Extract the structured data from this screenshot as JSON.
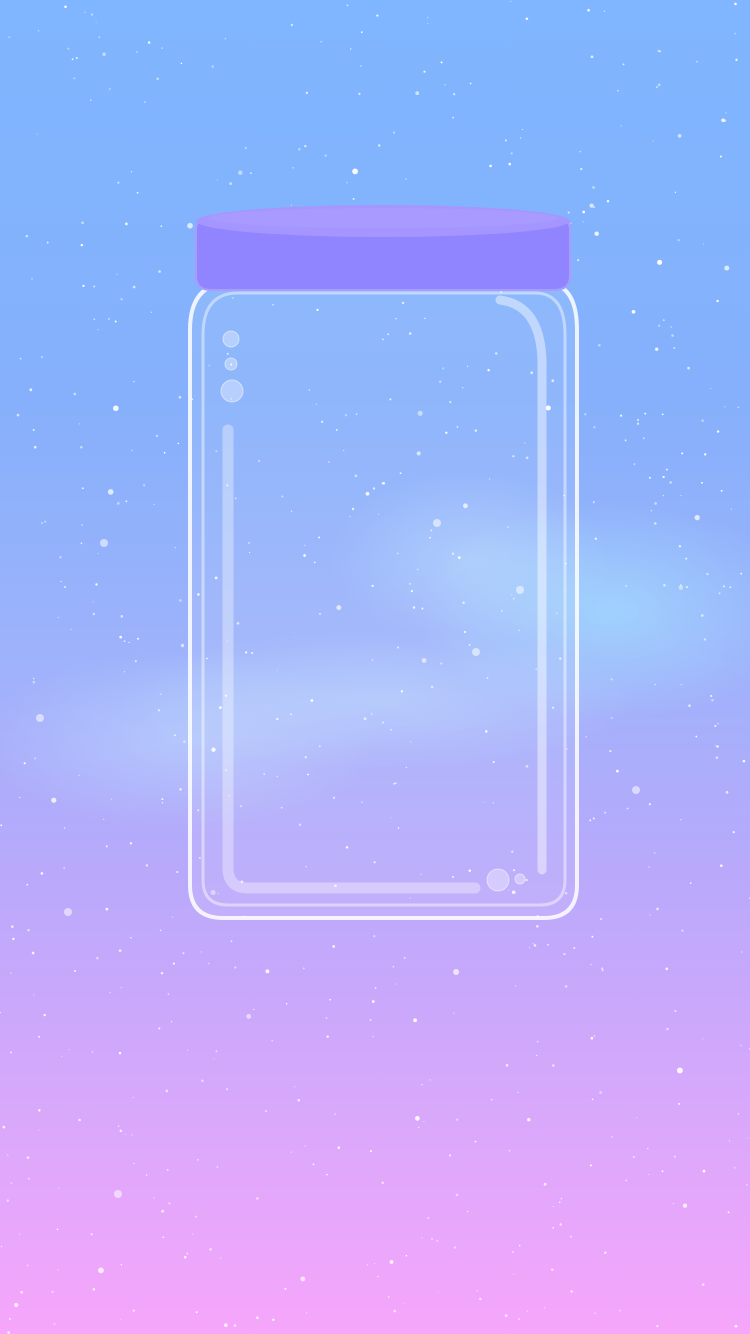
{
  "scene": {
    "gradient_colors": [
      "#7fb6ff",
      "#86b0fb",
      "#9fb2fb",
      "#b8a9fb",
      "#d6a8fb",
      "#f6a6fb"
    ],
    "nebula_color": "#9fe6ff",
    "star_color": "#ffffff"
  },
  "jar": {
    "lid_color": "#9185ff",
    "lid_top_color": "#a596ff",
    "outline_color": "#ffffff",
    "icon": "empty-jar"
  }
}
